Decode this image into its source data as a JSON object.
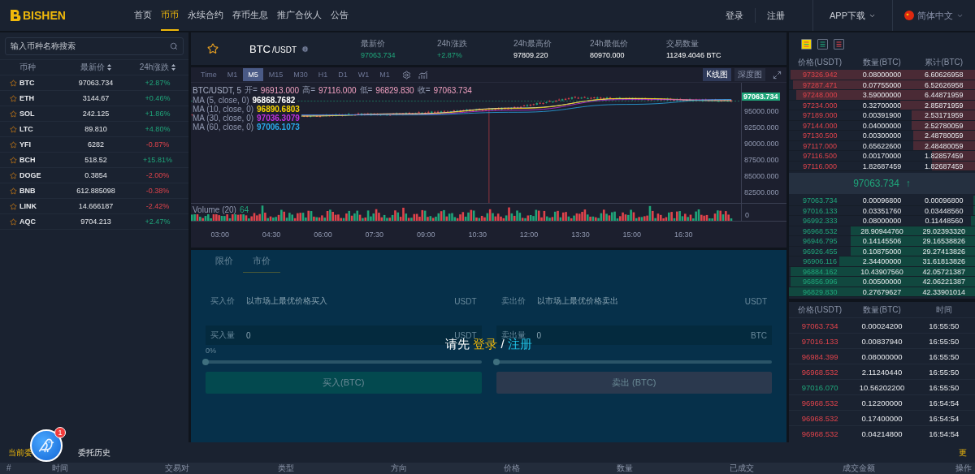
{
  "nav": {
    "logo": "BISHEN",
    "items": [
      {
        "label": "首页",
        "selected": false
      },
      {
        "label": "币币",
        "selected": true
      },
      {
        "label": "永续合约",
        "selected": false
      },
      {
        "label": "存币生息",
        "selected": false
      },
      {
        "label": "推广合伙人",
        "selected": false
      },
      {
        "label": "公告",
        "selected": false
      }
    ],
    "login": "登录",
    "register": "注册",
    "app_download": "APP下载",
    "language": "简体中文"
  },
  "market_list": {
    "search_placeholder": "输入币种名称搜索",
    "columns": [
      "币种",
      "最新价",
      "24h涨跌"
    ],
    "rows": [
      {
        "symbol": "BTC",
        "price": "97063.734",
        "change": "+2.87%",
        "kind": "gain"
      },
      {
        "symbol": "ETH",
        "price": "3144.67",
        "change": "+0.46%",
        "kind": "gain"
      },
      {
        "symbol": "SOL",
        "price": "242.125",
        "change": "+1.86%",
        "kind": "gain"
      },
      {
        "symbol": "LTC",
        "price": "89.810",
        "change": "+4.80%",
        "kind": "gain"
      },
      {
        "symbol": "YFI",
        "price": "6282",
        "change": "-0.87%",
        "kind": "loss"
      },
      {
        "symbol": "BCH",
        "price": "518.52",
        "change": "+15.81%",
        "kind": "gain"
      },
      {
        "symbol": "DOGE",
        "price": "0.3854",
        "change": "-2.00%",
        "kind": "loss"
      },
      {
        "symbol": "BNB",
        "price": "612.885098",
        "change": "-0.38%",
        "kind": "loss"
      },
      {
        "symbol": "LINK",
        "price": "14.666187",
        "change": "-2.42%",
        "kind": "loss"
      },
      {
        "symbol": "AQC",
        "price": "9704.213",
        "change": "+2.47%",
        "kind": "gain"
      }
    ]
  },
  "ticker": {
    "base": "BTC",
    "quote": "/USDT",
    "stats": [
      {
        "label": "最新价",
        "value": "97063.734",
        "kind": "gain"
      },
      {
        "label": "24h涨跌",
        "value": "+2.87%",
        "kind": "gain"
      },
      {
        "label": "24h最高价",
        "value": "97809.220",
        "kind": "plain"
      },
      {
        "label": "24h最低价",
        "value": "80970.000",
        "kind": "plain"
      },
      {
        "label": "交易数量",
        "value": "11249.4046 BTC",
        "kind": "plain"
      }
    ]
  },
  "chart": {
    "intervals": [
      {
        "label": "Time",
        "selected": false
      },
      {
        "label": "M1",
        "selected": false
      },
      {
        "label": "M5",
        "selected": true
      },
      {
        "label": "M15",
        "selected": false
      },
      {
        "label": "M30",
        "selected": false
      },
      {
        "label": "H1",
        "selected": false
      },
      {
        "label": "D1",
        "selected": false
      },
      {
        "label": "W1",
        "selected": false
      },
      {
        "label": "M1",
        "selected": false
      }
    ],
    "views": [
      {
        "label": "K线图",
        "selected": true
      },
      {
        "label": "深度图",
        "selected": false
      }
    ],
    "legend": {
      "title": "BTC/USDT, 5",
      "ohlc": [
        {
          "label": "开=",
          "value": "96913.000"
        },
        {
          "label": "高=",
          "value": "97116.000"
        },
        {
          "label": "低=",
          "value": "96829.830"
        },
        {
          "label": "收=",
          "value": "97063.734"
        }
      ]
    },
    "ma": [
      {
        "label": "MA (5, close, 0)",
        "value": "96868.7682",
        "color": "#ffffff"
      },
      {
        "label": "MA (10, close, 0)",
        "value": "96890.6803",
        "color": "#f5d300"
      },
      {
        "label": "MA (30, close, 0)",
        "value": "97036.3079",
        "color": "#c030e0"
      },
      {
        "label": "MA (60, close, 0)",
        "value": "97006.1073",
        "color": "#2aa8e8"
      }
    ],
    "price_tag": "97063.734",
    "price_ticks": [
      "95000.000",
      "92500.000",
      "90000.000",
      "87500.000",
      "85000.000",
      "82500.000"
    ],
    "volume_label": "Volume (20)",
    "volume_value": "64",
    "volume_tick": "0",
    "time_ticks": [
      "03:00",
      "04:30",
      "06:00",
      "07:30",
      "09:00",
      "10:30",
      "12:00",
      "13:30",
      "15:00",
      "16:30"
    ]
  },
  "order_form": {
    "tabs": [
      {
        "label": "限价",
        "selected": false
      },
      {
        "label": "市价",
        "selected": true
      }
    ],
    "sides": [
      {
        "kind": "buy",
        "price_label": "买入价",
        "price_value": "以市场上最优价格买入",
        "price_unit": "USDT",
        "amount_label": "买入量",
        "amount_value": "0",
        "amount_unit": "USDT",
        "percent": "0%",
        "level": 0,
        "button": "买入(BTC)"
      },
      {
        "kind": "sell",
        "price_label": "卖出价",
        "price_value": "以市场上最优价格卖出",
        "price_unit": "USDT",
        "amount_label": "卖出量",
        "amount_value": "0",
        "amount_unit": "BTC",
        "level": 0,
        "button": "卖出 (BTC)"
      }
    ]
  },
  "login_prompt": {
    "text": "请先",
    "login": "登录",
    "separator": "/",
    "register": "注册"
  },
  "order_book": {
    "views": [
      {
        "kind": "both",
        "selected": true
      },
      {
        "kind": "bids",
        "selected": false
      },
      {
        "kind": "asks",
        "selected": false
      }
    ],
    "columns": [
      "价格(USDT)",
      "数量(BTC)",
      "累计(BTC)"
    ],
    "asks": [
      {
        "price": "97326.942",
        "amount": "0.08000000",
        "total": "6.60626958",
        "level": 0.99
      },
      {
        "price": "97287.471",
        "amount": "0.07755000",
        "total": "6.52626958",
        "level": 0.98
      },
      {
        "price": "97248.000",
        "amount": "3.59000000",
        "total": "6.44871959",
        "level": 0.96
      },
      {
        "price": "97234.000",
        "amount": "0.32700000",
        "total": "2.85871959",
        "level": 0.4
      },
      {
        "price": "97189.000",
        "amount": "0.00391900",
        "total": "2.53171959",
        "level": 0.34
      },
      {
        "price": "97144.000",
        "amount": "0.04000000",
        "total": "2.52780059",
        "level": 0.34
      },
      {
        "price": "97130.500",
        "amount": "0.00300000",
        "total": "2.48780059",
        "level": 0.33
      },
      {
        "price": "97117.000",
        "amount": "0.65622600",
        "total": "2.48480059",
        "level": 0.33
      },
      {
        "price": "97116.500",
        "amount": "0.00170000",
        "total": "1.82857459",
        "level": 0.23
      },
      {
        "price": "97116.000",
        "amount": "1.82687459",
        "total": "1.82687459",
        "level": 0.23
      }
    ],
    "last_price": "97063.734",
    "last_arrow": "↑",
    "bids": [
      {
        "price": "97063.734",
        "amount": "0.00096800",
        "total": "0.00096800",
        "level": 0.01
      },
      {
        "price": "97016.133",
        "amount": "0.03351760",
        "total": "0.03448560",
        "level": 0.01
      },
      {
        "price": "96992.333",
        "amount": "0.08000000",
        "total": "0.11448560",
        "level": 0.02
      },
      {
        "price": "96968.532",
        "amount": "28.90944760",
        "total": "29.02393320",
        "level": 0.67
      },
      {
        "price": "96946.795",
        "amount": "0.14145506",
        "total": "29.16538826",
        "level": 0.67
      },
      {
        "price": "96926.455",
        "amount": "0.10875000",
        "total": "29.27413826",
        "level": 0.67
      },
      {
        "price": "96906.116",
        "amount": "2.34400000",
        "total": "31.61813826",
        "level": 0.73
      },
      {
        "price": "96884.162",
        "amount": "10.43907560",
        "total": "42.05721387",
        "level": 0.99
      },
      {
        "price": "96856.996",
        "amount": "0.00500000",
        "total": "42.06221387",
        "level": 0.99
      },
      {
        "price": "96829.830",
        "amount": "0.27679627",
        "total": "42.33901014",
        "level": 1
      }
    ]
  },
  "trades": {
    "columns": [
      "价格(USDT)",
      "数量(BTC)",
      "时间"
    ],
    "rows": [
      {
        "price": "97063.734",
        "amount": "0.00024200",
        "time": "16:55:50",
        "kind": "sell"
      },
      {
        "price": "97016.133",
        "amount": "0.00837940",
        "time": "16:55:50",
        "kind": "sell"
      },
      {
        "price": "96984.399",
        "amount": "0.08000000",
        "time": "16:55:50",
        "kind": "sell"
      },
      {
        "price": "96968.532",
        "amount": "2.11240440",
        "time": "16:55:50",
        "kind": "sell"
      },
      {
        "price": "97016.070",
        "amount": "10.56202200",
        "time": "16:55:50",
        "kind": "buy"
      },
      {
        "price": "96968.532",
        "amount": "0.12200000",
        "time": "16:54:54",
        "kind": "sell"
      },
      {
        "price": "96968.532",
        "amount": "0.17400000",
        "time": "16:54:54",
        "kind": "sell"
      },
      {
        "price": "96968.532",
        "amount": "0.04214800",
        "time": "16:54:54",
        "kind": "sell"
      }
    ]
  },
  "orders": {
    "tabs": [
      {
        "label": "当前委",
        "selected": true
      },
      {
        "label": "委托历史",
        "selected": false
      }
    ],
    "more": "更",
    "columns": [
      "#",
      "时间",
      "交易对",
      "类型",
      "方向",
      "价格",
      "数量",
      "已成交",
      "成交金额",
      "操作"
    ]
  },
  "chat_widget": {
    "badge": "1"
  }
}
